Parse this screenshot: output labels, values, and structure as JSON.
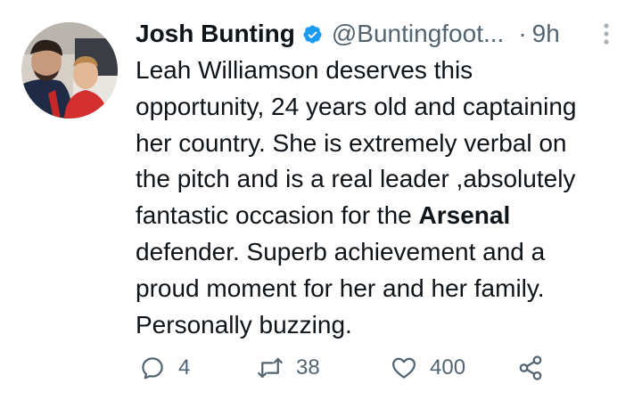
{
  "author": {
    "name": "Josh Bunting",
    "handle": "@Buntingfoot...",
    "separator": "·",
    "time": "9h",
    "verified": true
  },
  "tweet": {
    "line1": "Leah Williamson deserves this",
    "line2": "opportunity, 24 years old and captaining",
    "line3": "her country. She is extremely verbal on",
    "line4": "the pitch and is a real leader ,absolutely",
    "line5_pre": "fantastic occasion for the ",
    "line5_bold": "Arsenal",
    "line6": "defender. Superb achievement and a",
    "line7": "proud moment for her and her family.",
    "line8": "Personally buzzing."
  },
  "actions": {
    "reply_count": "4",
    "retweet_count": "38",
    "like_count": "400"
  },
  "icons": {
    "verified": "verified-badge-icon",
    "more": "more-vertical-icon",
    "reply": "reply-icon",
    "retweet": "retweet-icon",
    "like": "heart-icon",
    "share": "share-icon"
  },
  "colors": {
    "text": "#0f1419",
    "secondary": "#536471",
    "verified": "#1d9bf0"
  }
}
